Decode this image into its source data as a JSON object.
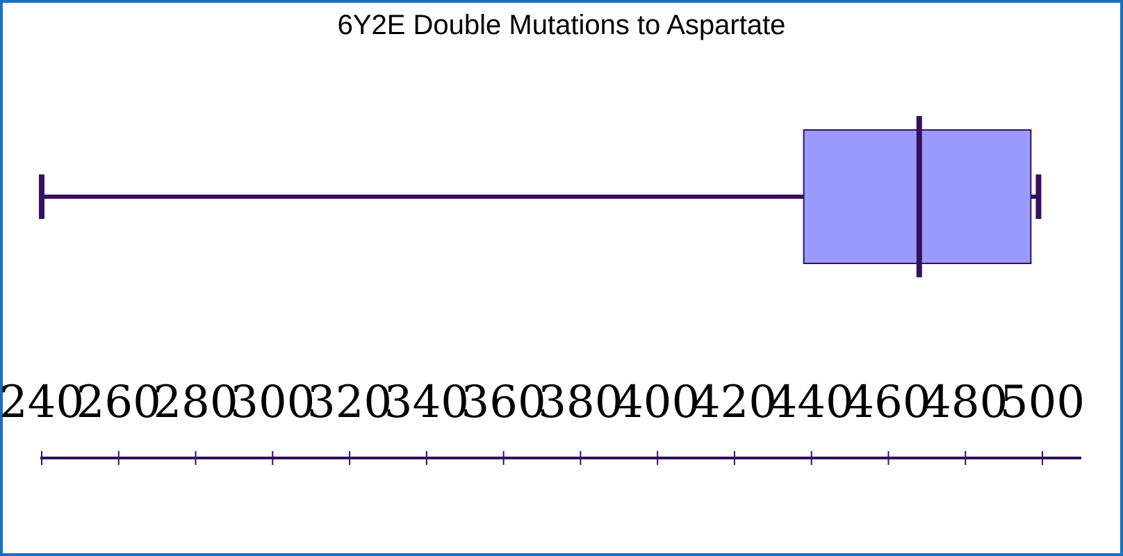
{
  "chart_data": {
    "type": "boxplot",
    "title": "6Y2E Double Mutations to Aspartate",
    "xlabel": "",
    "ylabel": "",
    "xlim": [
      240,
      510
    ],
    "ticks": [
      240,
      260,
      280,
      300,
      320,
      340,
      360,
      380,
      400,
      420,
      440,
      460,
      480,
      500
    ],
    "tick_labels": [
      "240",
      "260",
      "280",
      "300",
      "320",
      "340",
      "360",
      "380",
      "400",
      "420",
      "440",
      "460",
      "480",
      "500"
    ],
    "box": {
      "min": 240,
      "q1": 438,
      "median": 468,
      "q3": 497,
      "max": 499
    },
    "grid": false,
    "legend": "none",
    "colors": {
      "box_fill": "#9b9bfd",
      "stroke": "#35105e",
      "frame": "#1a6fbf"
    }
  }
}
